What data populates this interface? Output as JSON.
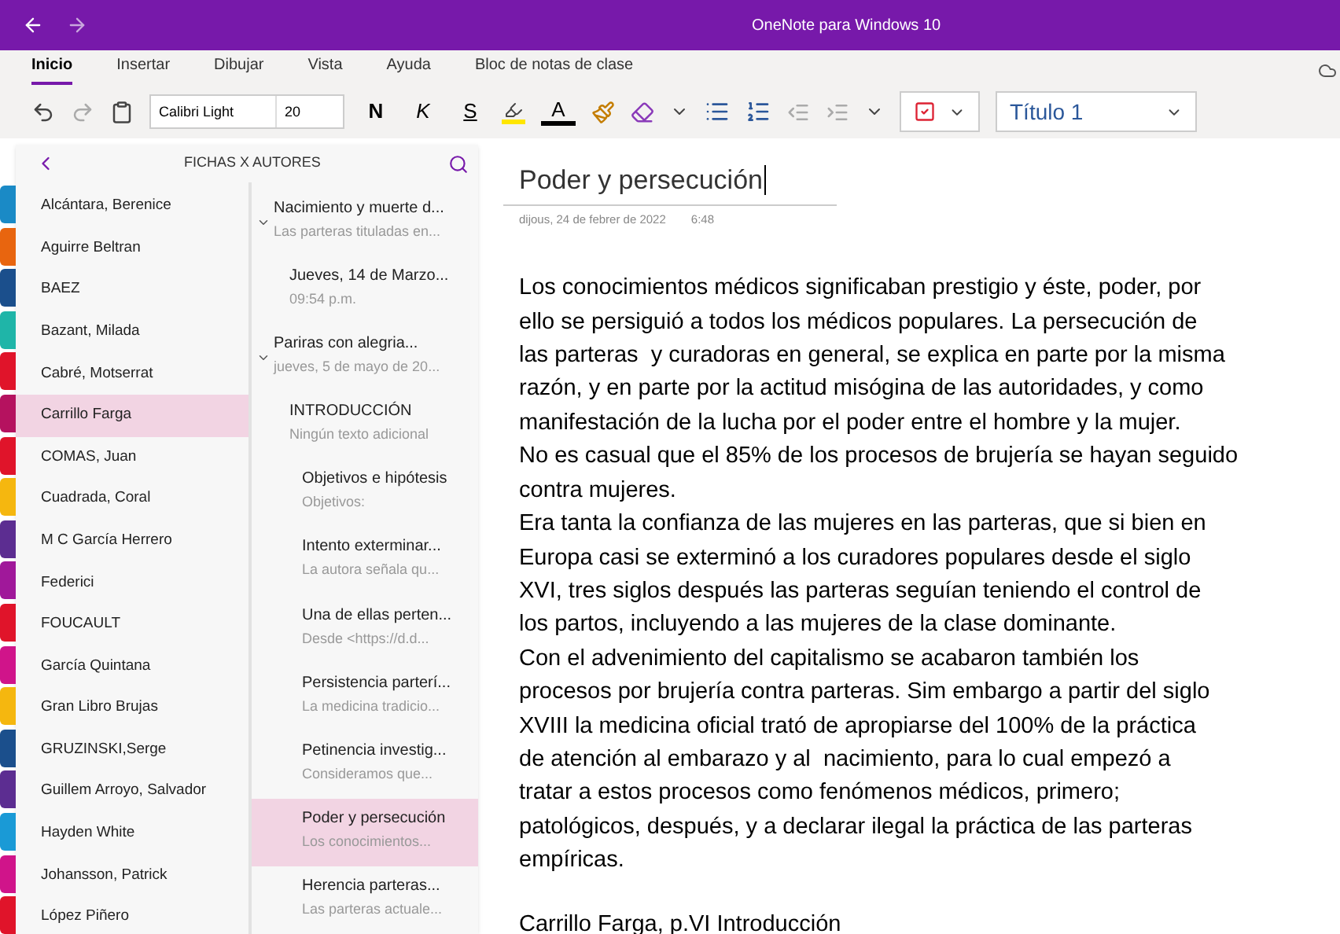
{
  "window": {
    "title": "OneNote para Windows 10"
  },
  "ribbon_tabs": [
    {
      "label": "Inicio",
      "selected": true
    },
    {
      "label": "Insertar",
      "selected": false
    },
    {
      "label": "Dibujar",
      "selected": false
    },
    {
      "label": "Vista",
      "selected": false
    },
    {
      "label": "Ayuda",
      "selected": false
    },
    {
      "label": "Bloc de notas de clase",
      "selected": false
    }
  ],
  "toolbar": {
    "font": "Calibri Light",
    "size": "20",
    "bold": "N",
    "italic": "K",
    "underline": "S",
    "font_color": "A",
    "style": "Título 1"
  },
  "notebook": {
    "title": "FICHAS X AUTORES"
  },
  "sections": [
    {
      "name": "Alcántara, Berenice",
      "color": "#1a8ac6",
      "selected": false
    },
    {
      "name": "Aguirre Beltran",
      "color": "#e8650f",
      "selected": false
    },
    {
      "name": "BAEZ",
      "color": "#1b4f8c",
      "selected": false
    },
    {
      "name": "Bazant, Milada",
      "color": "#1fb5a8",
      "selected": false
    },
    {
      "name": "Cabré, Motserrat",
      "color": "#e0142a",
      "selected": false
    },
    {
      "name": "Carrillo Farga",
      "color": "#b5125f",
      "selected": true
    },
    {
      "name": "COMAS, Juan",
      "color": "#e0142a",
      "selected": false
    },
    {
      "name": "Cuadrada, Coral",
      "color": "#f5b70f",
      "selected": false
    },
    {
      "name": "M C García Herrero",
      "color": "#5c2d91",
      "selected": false
    },
    {
      "name": "Federici",
      "color": "#a0189a",
      "selected": false
    },
    {
      "name": "FOUCAULT",
      "color": "#e0142a",
      "selected": false
    },
    {
      "name": "García Quintana",
      "color": "#d0148a",
      "selected": false
    },
    {
      "name": "Gran Libro Brujas",
      "color": "#f5b70f",
      "selected": false
    },
    {
      "name": "GRUZINSKI,Serge",
      "color": "#1b4f8c",
      "selected": false
    },
    {
      "name": "Guillem Arroyo, Salvador",
      "color": "#5c2d91",
      "selected": false
    },
    {
      "name": "Hayden White",
      "color": "#1a9ad6",
      "selected": false
    },
    {
      "name": "Johansson, Patrick",
      "color": "#d0148a",
      "selected": false
    },
    {
      "name": "López Piñero",
      "color": "#e0142a",
      "selected": false
    }
  ],
  "pages": [
    {
      "title": "Nacimiento y muerte d...",
      "preview": "Las parteras tituladas en...",
      "expanded": true,
      "selected": false,
      "children": [
        {
          "title": "Jueves, 14 de Marzo...",
          "preview": "09:54 p.m.",
          "selected": false
        }
      ]
    },
    {
      "title": "Pariras con alegria...",
      "preview": "jueves, 5 de mayo de 20...",
      "expanded": true,
      "selected": false,
      "children": [
        {
          "title": "INTRODUCCIÓN",
          "preview": "Ningún texto adicional",
          "selected": false,
          "children": [
            {
              "title": "Objetivos e hipótesis",
              "preview": "Objetivos:",
              "selected": false
            },
            {
              "title": "Intento exterminar...",
              "preview": "La autora señala qu...",
              "selected": false
            },
            {
              "title": "Una de ellas perten...",
              "preview": "Desde <https://d.d...",
              "selected": false
            },
            {
              "title": "Persistencia parterí...",
              "preview": "La medicina tradicio...",
              "selected": false
            },
            {
              "title": "Petinencia investig...",
              "preview": "Consideramos que...",
              "selected": false
            },
            {
              "title": "Poder y persecución",
              "preview": "Los conocimientos...",
              "selected": true
            },
            {
              "title": "Herencia parteras...",
              "preview": "Las parteras actuale...",
              "selected": false
            }
          ]
        }
      ]
    }
  ],
  "page": {
    "title": "Poder y persecución",
    "date": "dijous, 24 de febrer de 2022",
    "time": "6:48",
    "lines": [
      "Los conocimientos médicos significaban prestigio y éste, poder, por",
      "ello se persiguió a todos los médicos populares. La persecución de",
      "las parteras  y curadoras en general, se explica en parte por la misma",
      "razón, y en parte por la actitud misógina de las autoridades, y como",
      "manifestación de la lucha por el poder entre el hombre y la mujer.",
      "No es casual que el 85% de los procesos de brujería se hayan seguido",
      "contra mujeres.",
      "Era tanta la confianza de las mujeres en las parteras, que si bien en",
      "Europa casi se exterminó a los curadores populares desde el siglo",
      "XVI, tres siglos después las parteras seguían teniendo el control de",
      "los partos, incluyendo a las mujeres de la clase dominante.",
      "Con el advenimiento del capitalismo se acabaron también los",
      "procesos por brujería contra parteras. Sim embargo a partir del siglo",
      "XVIII la medicina oficial trató de apropiarse del 100% de la práctica",
      "de atención al embarazo y al  nacimiento, para lo cual empezó a",
      "tratar a estos procesos como fenómenos médicos, primero;",
      "patológicos, después, y a declarar ilegal la práctica de las parteras",
      "empíricas."
    ],
    "source": "Carrillo Farga, p.VI Introducción"
  }
}
